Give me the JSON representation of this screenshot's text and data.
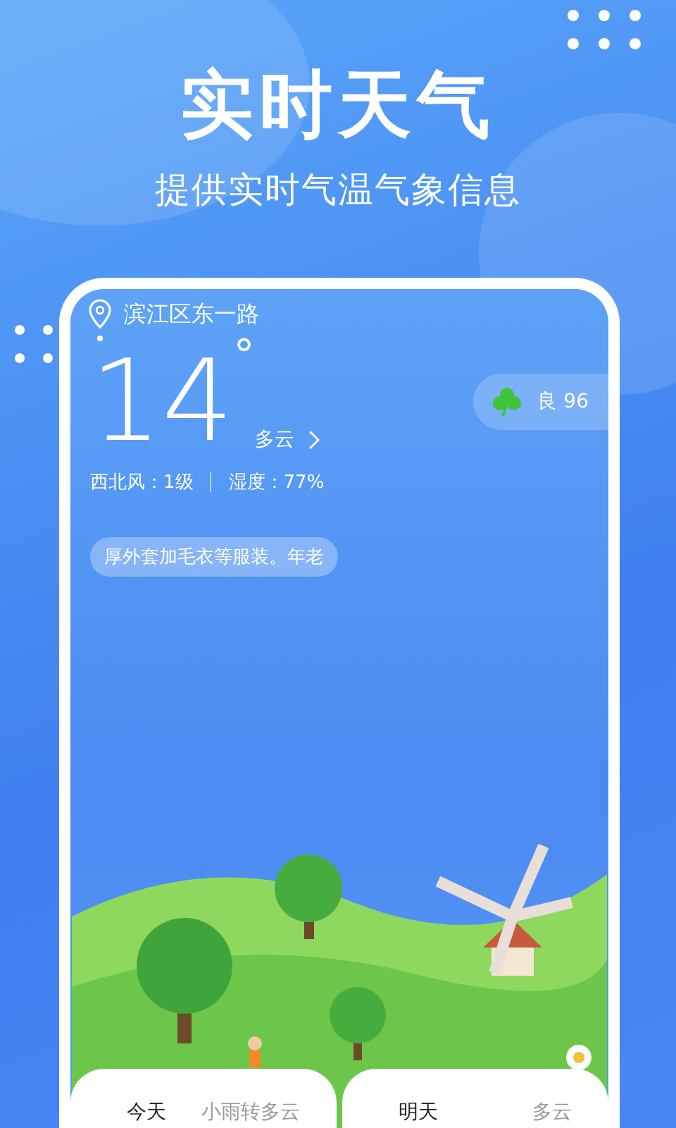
{
  "header": {
    "title": "实时天气",
    "subtitle": "提供实时气温气象信息"
  },
  "weather": {
    "location": "滨江区东一路",
    "temperature": "14",
    "degree": "°",
    "condition": "多云",
    "wind": "西北风：1级",
    "humidity": "湿度：77%",
    "aqi": "良 96",
    "tip": "厚外套加毛衣等服装。年老"
  },
  "forecast": [
    {
      "day": "今天",
      "condition": "小雨转多云"
    },
    {
      "day": "明天",
      "condition": "多云"
    }
  ]
}
